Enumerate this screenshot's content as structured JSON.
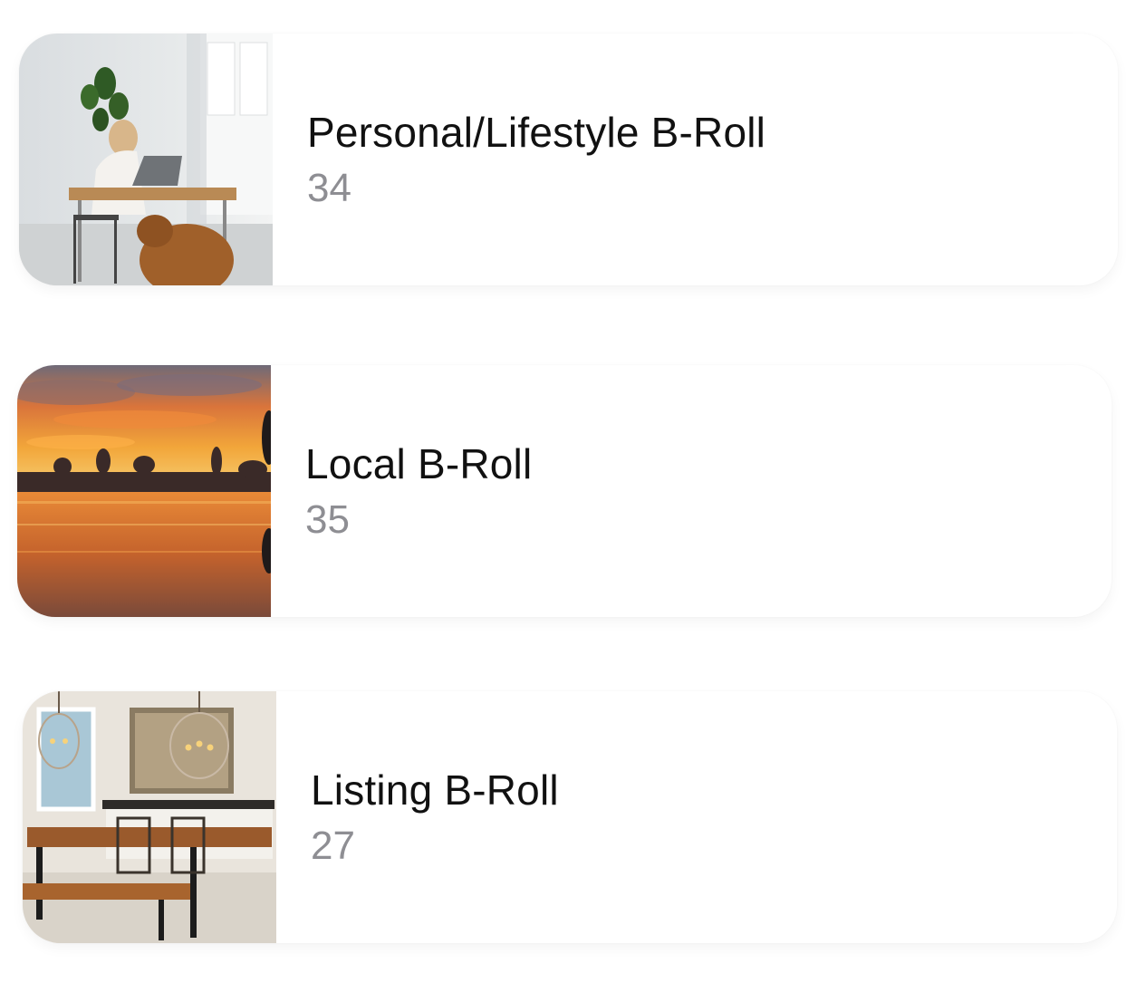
{
  "albums": [
    {
      "title": "Personal/Lifestyle B-Roll",
      "count": "34",
      "thumbnail": "woman-desk-dog-photo"
    },
    {
      "title": "Local B-Roll",
      "count": "35",
      "thumbnail": "sunset-waterfront-photo"
    },
    {
      "title": "Listing B-Roll",
      "count": "27",
      "thumbnail": "dining-room-photo"
    }
  ],
  "colors": {
    "title": "#111111",
    "count": "#8e8e93",
    "card_background": "#ffffff"
  }
}
